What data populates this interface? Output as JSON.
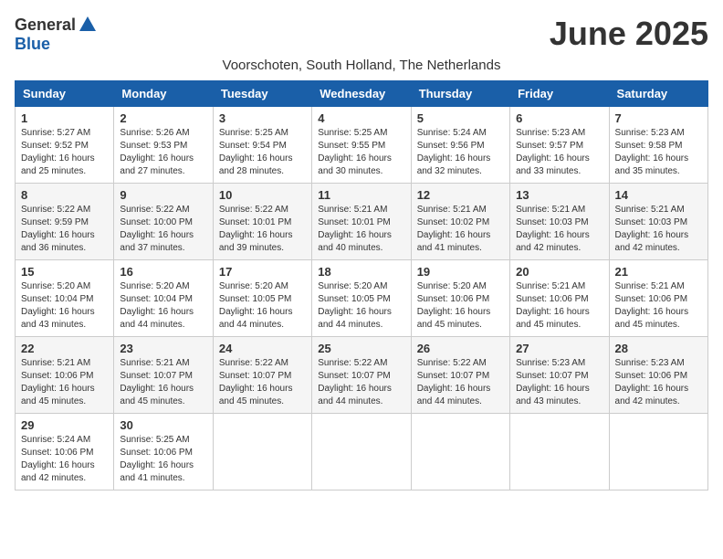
{
  "logo": {
    "general": "General",
    "blue": "Blue"
  },
  "title": "June 2025",
  "subtitle": "Voorschoten, South Holland, The Netherlands",
  "headers": [
    "Sunday",
    "Monday",
    "Tuesday",
    "Wednesday",
    "Thursday",
    "Friday",
    "Saturday"
  ],
  "weeks": [
    [
      {
        "day": "1",
        "sunrise": "5:27 AM",
        "sunset": "9:52 PM",
        "daylight": "16 hours and 25 minutes."
      },
      {
        "day": "2",
        "sunrise": "5:26 AM",
        "sunset": "9:53 PM",
        "daylight": "16 hours and 27 minutes."
      },
      {
        "day": "3",
        "sunrise": "5:25 AM",
        "sunset": "9:54 PM",
        "daylight": "16 hours and 28 minutes."
      },
      {
        "day": "4",
        "sunrise": "5:25 AM",
        "sunset": "9:55 PM",
        "daylight": "16 hours and 30 minutes."
      },
      {
        "day": "5",
        "sunrise": "5:24 AM",
        "sunset": "9:56 PM",
        "daylight": "16 hours and 32 minutes."
      },
      {
        "day": "6",
        "sunrise": "5:23 AM",
        "sunset": "9:57 PM",
        "daylight": "16 hours and 33 minutes."
      },
      {
        "day": "7",
        "sunrise": "5:23 AM",
        "sunset": "9:58 PM",
        "daylight": "16 hours and 35 minutes."
      }
    ],
    [
      {
        "day": "8",
        "sunrise": "5:22 AM",
        "sunset": "9:59 PM",
        "daylight": "16 hours and 36 minutes."
      },
      {
        "day": "9",
        "sunrise": "5:22 AM",
        "sunset": "10:00 PM",
        "daylight": "16 hours and 37 minutes."
      },
      {
        "day": "10",
        "sunrise": "5:22 AM",
        "sunset": "10:01 PM",
        "daylight": "16 hours and 39 minutes."
      },
      {
        "day": "11",
        "sunrise": "5:21 AM",
        "sunset": "10:01 PM",
        "daylight": "16 hours and 40 minutes."
      },
      {
        "day": "12",
        "sunrise": "5:21 AM",
        "sunset": "10:02 PM",
        "daylight": "16 hours and 41 minutes."
      },
      {
        "day": "13",
        "sunrise": "5:21 AM",
        "sunset": "10:03 PM",
        "daylight": "16 hours and 42 minutes."
      },
      {
        "day": "14",
        "sunrise": "5:21 AM",
        "sunset": "10:03 PM",
        "daylight": "16 hours and 42 minutes."
      }
    ],
    [
      {
        "day": "15",
        "sunrise": "5:20 AM",
        "sunset": "10:04 PM",
        "daylight": "16 hours and 43 minutes."
      },
      {
        "day": "16",
        "sunrise": "5:20 AM",
        "sunset": "10:04 PM",
        "daylight": "16 hours and 44 minutes."
      },
      {
        "day": "17",
        "sunrise": "5:20 AM",
        "sunset": "10:05 PM",
        "daylight": "16 hours and 44 minutes."
      },
      {
        "day": "18",
        "sunrise": "5:20 AM",
        "sunset": "10:05 PM",
        "daylight": "16 hours and 44 minutes."
      },
      {
        "day": "19",
        "sunrise": "5:20 AM",
        "sunset": "10:06 PM",
        "daylight": "16 hours and 45 minutes."
      },
      {
        "day": "20",
        "sunrise": "5:21 AM",
        "sunset": "10:06 PM",
        "daylight": "16 hours and 45 minutes."
      },
      {
        "day": "21",
        "sunrise": "5:21 AM",
        "sunset": "10:06 PM",
        "daylight": "16 hours and 45 minutes."
      }
    ],
    [
      {
        "day": "22",
        "sunrise": "5:21 AM",
        "sunset": "10:06 PM",
        "daylight": "16 hours and 45 minutes."
      },
      {
        "day": "23",
        "sunrise": "5:21 AM",
        "sunset": "10:07 PM",
        "daylight": "16 hours and 45 minutes."
      },
      {
        "day": "24",
        "sunrise": "5:22 AM",
        "sunset": "10:07 PM",
        "daylight": "16 hours and 45 minutes."
      },
      {
        "day": "25",
        "sunrise": "5:22 AM",
        "sunset": "10:07 PM",
        "daylight": "16 hours and 44 minutes."
      },
      {
        "day": "26",
        "sunrise": "5:22 AM",
        "sunset": "10:07 PM",
        "daylight": "16 hours and 44 minutes."
      },
      {
        "day": "27",
        "sunrise": "5:23 AM",
        "sunset": "10:07 PM",
        "daylight": "16 hours and 43 minutes."
      },
      {
        "day": "28",
        "sunrise": "5:23 AM",
        "sunset": "10:06 PM",
        "daylight": "16 hours and 42 minutes."
      }
    ],
    [
      {
        "day": "29",
        "sunrise": "5:24 AM",
        "sunset": "10:06 PM",
        "daylight": "16 hours and 42 minutes."
      },
      {
        "day": "30",
        "sunrise": "5:25 AM",
        "sunset": "10:06 PM",
        "daylight": "16 hours and 41 minutes."
      },
      null,
      null,
      null,
      null,
      null
    ]
  ],
  "labels": {
    "sunrise": "Sunrise:",
    "sunset": "Sunset:",
    "daylight": "Daylight:"
  }
}
